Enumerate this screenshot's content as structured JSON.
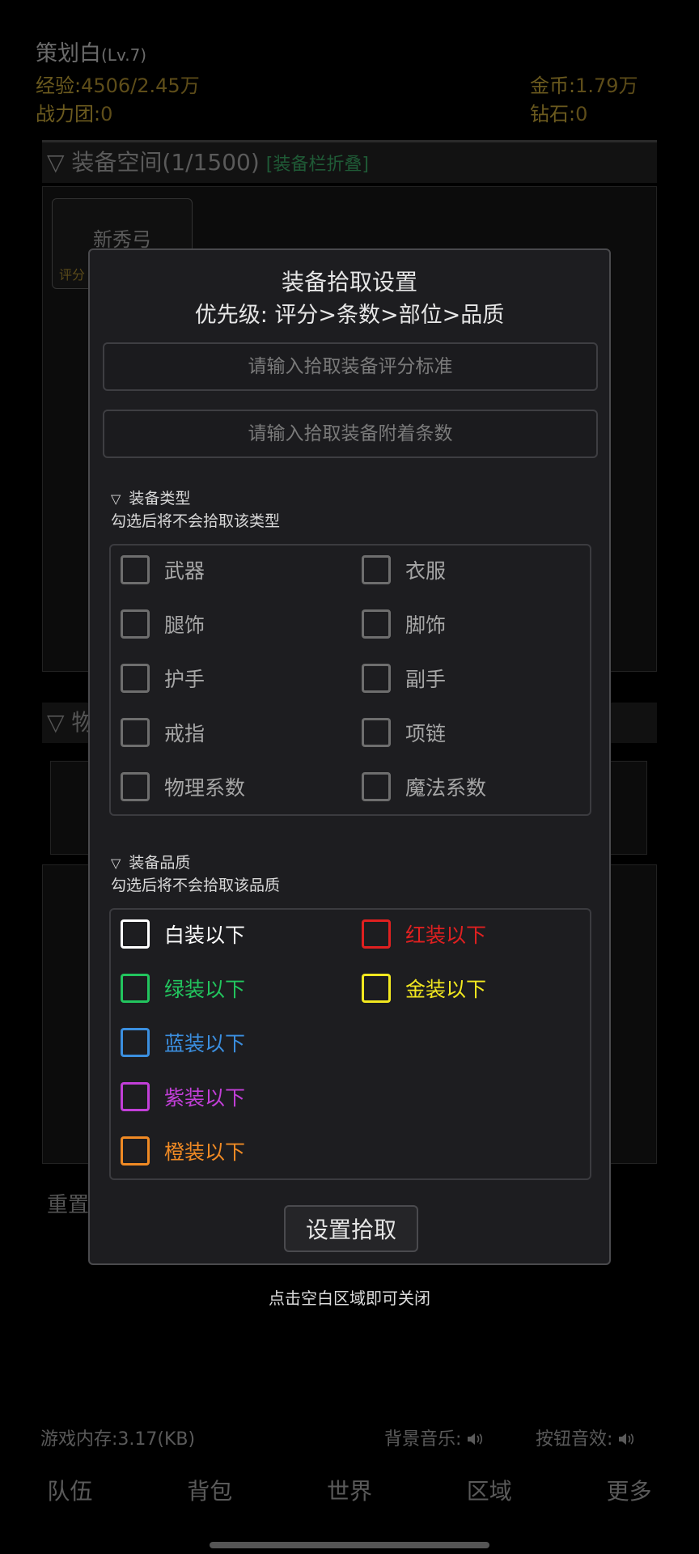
{
  "background": {
    "player_name": "策划白",
    "player_level": "(Lv.7)",
    "exp_label": "经验:",
    "exp_value": "4506/2.45万",
    "power_label": "战力团:",
    "power_value": "0",
    "gold_label": "金币:",
    "gold_value": "1.79万",
    "diamond_label": "钻石:",
    "diamond_value": "0",
    "equip_section_title": "▽ 装备空间(1/1500)",
    "equip_fold_label": "[装备栏折叠]",
    "item_name": "新秀弓",
    "item_score_label": "评分",
    "section2_title": "▽ 物",
    "reset_label": "重置",
    "memory_label": "游戏内存:",
    "memory_value": "3.17(KB)",
    "bgm_label": "背景音乐:",
    "sfx_label": "按钮音效:",
    "nav": [
      "队伍",
      "背包",
      "世界",
      "区域",
      "更多"
    ]
  },
  "modal": {
    "title": "装备拾取设置",
    "subtitle": "优先级: 评分>条数>部位>品质",
    "score_placeholder": "请输入拾取装备评分标准",
    "affix_placeholder": "请输入拾取装备附着条数",
    "type_section": "装备类型",
    "type_hint": "勾选后将不会拾取该类型",
    "types": [
      [
        "武器",
        "衣服"
      ],
      [
        "腿饰",
        "脚饰"
      ],
      [
        "护手",
        "副手"
      ],
      [
        "戒指",
        "项链"
      ],
      [
        "物理系数",
        "魔法系数"
      ]
    ],
    "quality_section": "装备品质",
    "quality_hint": "勾选后将不会拾取该品质",
    "qualities": {
      "white": {
        "label": "白装以下",
        "color": "#ffffff"
      },
      "red": {
        "label": "红装以下",
        "color": "#e02020"
      },
      "green": {
        "label": "绿装以下",
        "color": "#22c55e"
      },
      "gold": {
        "label": "金装以下",
        "color": "#f2e81f"
      },
      "blue": {
        "label": "蓝装以下",
        "color": "#3b8fe0"
      },
      "purple": {
        "label": "紫装以下",
        "color": "#c23fd8"
      },
      "orange": {
        "label": "橙装以下",
        "color": "#f08a24"
      }
    },
    "confirm_button": "设置拾取"
  },
  "close_hint": "点击空白区域即可关闭",
  "icons": {
    "speaker": "speaker-icon",
    "triangle": "triangle-down-icon"
  }
}
